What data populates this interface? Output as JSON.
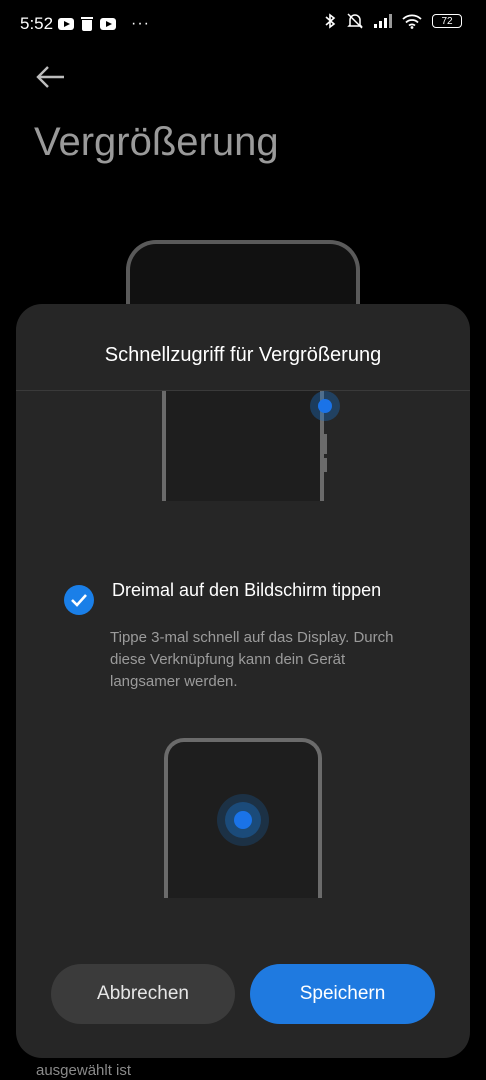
{
  "status_bar": {
    "time": "5:52",
    "battery": "72",
    "left_icons": [
      "youtube-icon",
      "trash-icon",
      "youtube-icon",
      "more-icon"
    ],
    "right_icons": [
      "bluetooth-icon",
      "mute-vibrate-icon",
      "signal-icon",
      "wifi-icon",
      "battery-icon"
    ]
  },
  "header": {
    "title": "Vergrößerung"
  },
  "dialog": {
    "title": "Schnellzugriff für Vergrößerung",
    "option": {
      "title": "Dreimal auf den Bildschirm tippen",
      "description": "Tippe 3-mal schnell auf das Display. Durch diese Verknüpfung kann dein Gerät langsamer werden.",
      "checked": true
    },
    "cancel_label": "Abbrechen",
    "save_label": "Speichern"
  },
  "background_peek_text": "ausgewählt ist",
  "colors": {
    "accent": "#1f7ae0",
    "sheet_bg": "#262626",
    "page_bg": "#000000"
  }
}
